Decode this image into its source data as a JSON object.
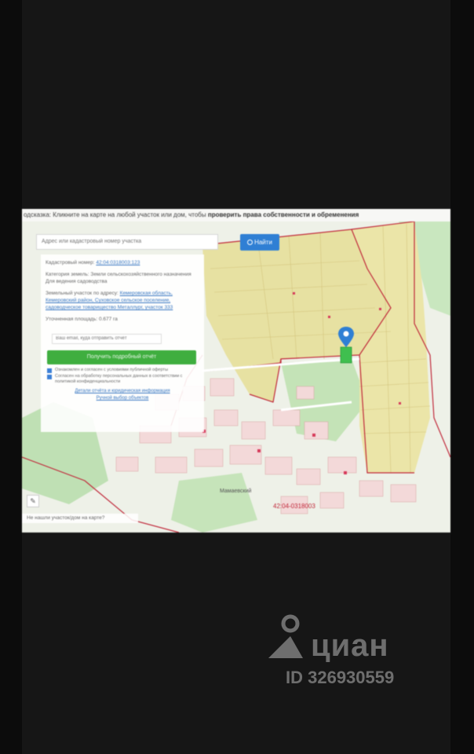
{
  "hint": {
    "prefix": "одсказка: Кликните на карте на любой участок или дом, чтобы ",
    "bold": "проверить права собственности и обременения"
  },
  "search": {
    "placeholder": "Адрес или кадастровый номер участка",
    "button": "Найти"
  },
  "parcel": {
    "cad_label": "Кадастровый номер:",
    "cad_value": "42:04:0318003:123",
    "category_label": "Категория земель:",
    "category_value": "Земли сельскохозяйственного назначения",
    "use_value": "Для ведения садоводства",
    "address_label": "Земельный участок по адресу:",
    "address_value": "Кемеровская область, Кемеровский район, Суховское сельское поселение, садоводческое товарищество Металлург, участок 333",
    "area_label": "Уточненная площадь:",
    "area_value": "0.677 га"
  },
  "panel": {
    "email_placeholder": "Ваш email, куда отправить отчёт",
    "order_button": "Получить подробный отчёт",
    "check1": "Ознакомлен и согласен с условиями публичной оферты",
    "check2": "Согласен на обработку персональных данных в соответствии с политикой конфиденциальности",
    "sample_link": "Детали отчёта и юридическая информация",
    "manual_link": "Ручной выбор объектов"
  },
  "map": {
    "street1": "Мамаевский",
    "cad_quarter": "42:04-0318003"
  },
  "bottom_note": "Не нашли участок/дом на карте?",
  "watermark": {
    "brand": "циан",
    "id": "ID 326930559"
  }
}
